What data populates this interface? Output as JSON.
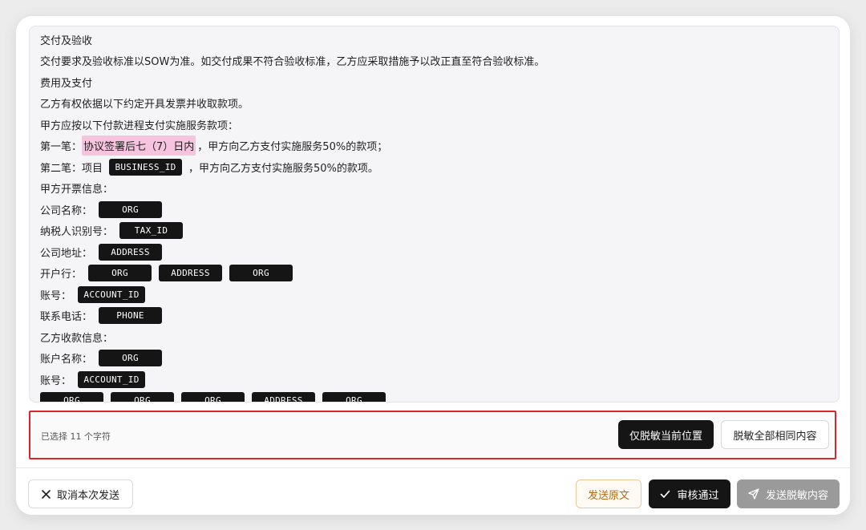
{
  "document": {
    "lines": [
      {
        "text": "交付及验收"
      },
      {
        "text": "交付要求及验收标准以SOW为准。如交付成果不符合验收标准，乙方应采取措施予以改正直至符合验收标准。"
      },
      {
        "text": "费用及支付"
      },
      {
        "text": "乙方有权依据以下约定开具发票并收取款项。"
      },
      {
        "text": "甲方应按以下付款进程支付实施服务款项："
      },
      {
        "prefix": "第一笔：",
        "highlight": "协议签署后七（7）日内",
        "suffix": "，甲方向乙方支付实施服务50%的款项；"
      },
      {
        "prefix": "第二笔：项目",
        "tag": "BUSINESS_ID",
        "suffix": "，甲方向乙方支付实施服务50%的款项。"
      },
      {
        "text": "甲方开票信息："
      },
      {
        "label": "公司名称：",
        "tags": [
          "ORG"
        ]
      },
      {
        "label": "纳税人识别号：",
        "tags": [
          "TAX_ID"
        ]
      },
      {
        "label": "公司地址：",
        "tags": [
          "ADDRESS"
        ]
      },
      {
        "label": "开户行：",
        "tags": [
          "ORG",
          "ADDRESS",
          "ORG"
        ]
      },
      {
        "label": "账号：",
        "tags": [
          "ACCOUNT_ID"
        ]
      },
      {
        "label": "联系电话：",
        "tags": [
          "PHONE"
        ]
      },
      {
        "text": "乙方收款信息："
      },
      {
        "label": "账户名称：",
        "tags": [
          "ORG"
        ]
      },
      {
        "label": "账号：",
        "tags": [
          "ACCOUNT_ID"
        ]
      },
      {
        "tags": [
          "ORG",
          "ORG",
          "ORG",
          "ADDRESS",
          "ORG"
        ]
      }
    ]
  },
  "selection": {
    "info": "已选择 11 个字符",
    "mask_current_label": "仅脱敏当前位置",
    "mask_all_label": "脱敏全部相同内容"
  },
  "footer": {
    "cancel_label": "取消本次发送",
    "send_original_label": "发送原文",
    "approve_label": "审核通过",
    "send_masked_label": "发送脱敏内容"
  },
  "icons": {
    "cancel": "close-icon",
    "approve": "check-icon",
    "send": "send-icon"
  },
  "colors": {
    "highlight": "#f6c4de",
    "tag_bg": "#151515",
    "selection_border": "#e0242a",
    "send_original_text": "#b36b16",
    "disabled_button": "#9a9a9a"
  }
}
